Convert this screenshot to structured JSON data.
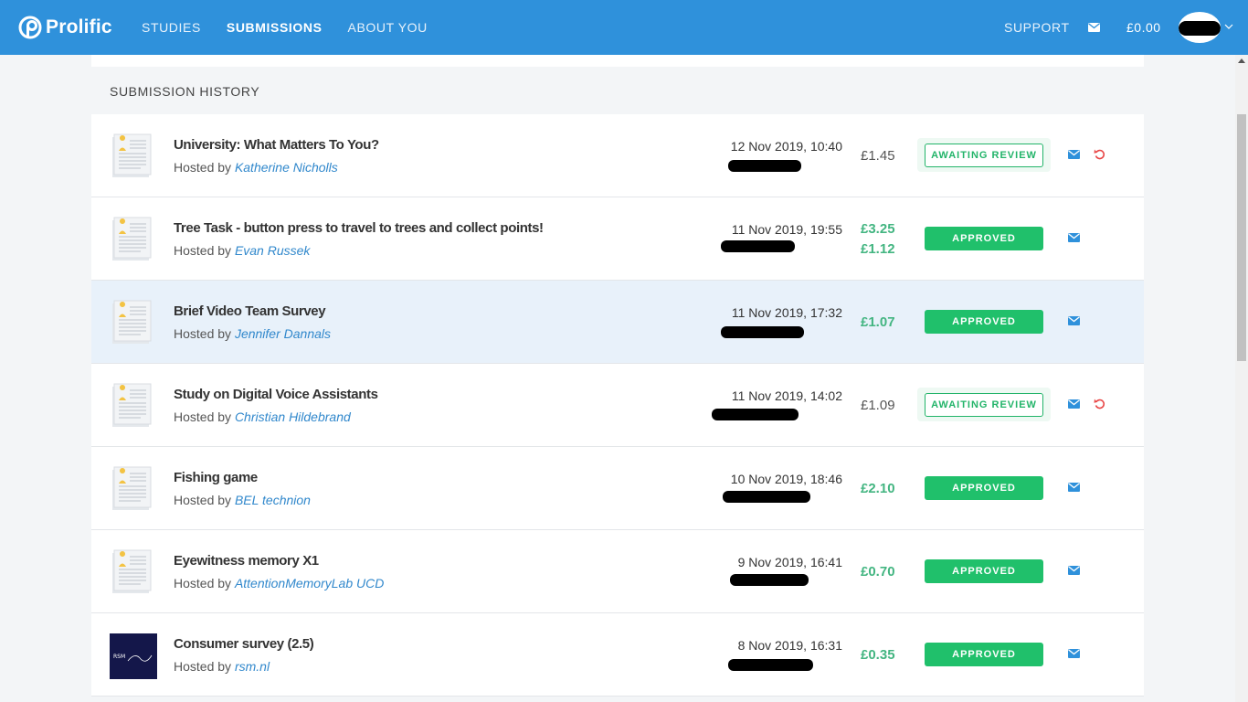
{
  "app": {
    "brand": "Prolific",
    "nav": [
      {
        "label": "STUDIES",
        "active": false
      },
      {
        "label": "SUBMISSIONS",
        "active": true
      },
      {
        "label": "ABOUT YOU",
        "active": false
      }
    ],
    "support_label": "SUPPORT",
    "balance": "£0.00",
    "header_color": "#2f91db"
  },
  "section_title": "SUBMISSION HISTORY",
  "submissions": [
    {
      "title": "University: What Matters To You?",
      "host_prefix": "Hosted by",
      "host": "Katherine Nicholls",
      "date": "12 Nov 2019, 10:40",
      "rewards": [
        "£1.45"
      ],
      "reward_style": "plain",
      "status": "AWAITING REVIEW",
      "status_type": "await",
      "icon": "document-icon",
      "can_return": true
    },
    {
      "title": "Tree Task - button press to travel to trees and collect points!",
      "host_prefix": "Hosted by",
      "host": "Evan Russek",
      "date": "11 Nov 2019, 19:55",
      "rewards": [
        "£3.25",
        "£1.12"
      ],
      "reward_style": "bonus",
      "status": "APPROVED",
      "status_type": "approved",
      "icon": "document-icon",
      "can_return": false
    },
    {
      "title": "Brief Video Team Survey",
      "host_prefix": "Hosted by",
      "host": "Jennifer Dannals",
      "date": "11 Nov 2019, 17:32",
      "rewards": [
        "£1.07"
      ],
      "reward_style": "bonus",
      "status": "APPROVED",
      "status_type": "approved",
      "icon": "document-icon",
      "can_return": false,
      "highlight": true
    },
    {
      "title": "Study on Digital Voice Assistants",
      "host_prefix": "Hosted by",
      "host": "Christian Hildebrand",
      "date": "11 Nov 2019, 14:02",
      "rewards": [
        "£1.09"
      ],
      "reward_style": "plain",
      "status": "AWAITING REVIEW",
      "status_type": "await",
      "icon": "document-icon",
      "can_return": true
    },
    {
      "title": "Fishing game",
      "host_prefix": "Hosted by",
      "host": "BEL technion",
      "date": "10 Nov 2019, 18:46",
      "rewards": [
        "£2.10"
      ],
      "reward_style": "bonus",
      "status": "APPROVED",
      "status_type": "approved",
      "icon": "document-icon",
      "can_return": false
    },
    {
      "title": "Eyewitness memory X1",
      "host_prefix": "Hosted by",
      "host": "AttentionMemoryLab UCD",
      "date": "9 Nov 2019, 16:41",
      "rewards": [
        "£0.70"
      ],
      "reward_style": "bonus",
      "status": "APPROVED",
      "status_type": "approved",
      "icon": "document-icon",
      "can_return": false
    },
    {
      "title": "Consumer survey (2.5)",
      "host_prefix": "Hosted by",
      "host": "rsm.nl",
      "date": "8 Nov 2019, 16:31",
      "rewards": [
        "£0.35"
      ],
      "reward_style": "bonus",
      "status": "APPROVED",
      "status_type": "approved",
      "icon": "rsm-logo",
      "logo_text": "RSM",
      "can_return": false
    }
  ]
}
